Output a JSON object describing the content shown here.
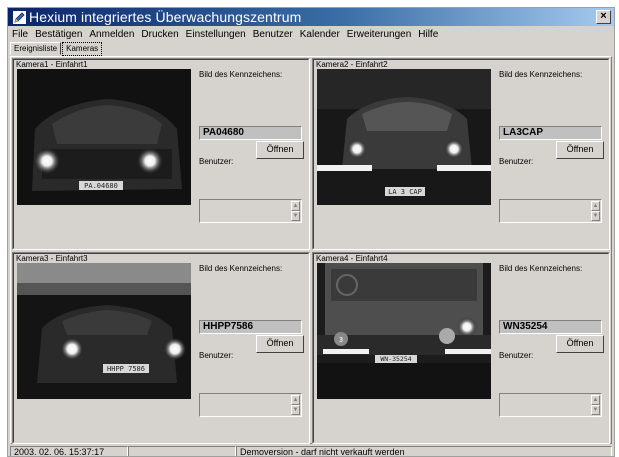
{
  "window": {
    "title": "Hexium integriertes Überwachungszentrum",
    "close_label": "×",
    "app_icon": "pen-icon"
  },
  "menu": [
    "File",
    "Bestätigen",
    "Anmelden",
    "Drucken",
    "Einstellungen",
    "Benutzer",
    "Kalender",
    "Erweiterungen",
    "Hilfe"
  ],
  "tabs": [
    {
      "label": "Ereignisliste",
      "active": false
    },
    {
      "label": "Kameras",
      "active": true
    }
  ],
  "cameras": [
    {
      "name": "Kamera1 - Einfahrt1",
      "plate_label": "Bild des Kennzeichens:",
      "plate": "PA04680",
      "photo_plate": "PA.04680",
      "user_label": "Benutzer:",
      "open_label": "Öffnen"
    },
    {
      "name": "Kamera2 - Einfahrt2",
      "plate_label": "Bild des Kennzeichens:",
      "plate": "LA3CAP",
      "photo_plate": "LA 3 CAP",
      "user_label": "Benutzer:",
      "open_label": "Öffnen"
    },
    {
      "name": "Kamera3 - Einfahrt3",
      "plate_label": "Bild des Kennzeichens:",
      "plate": "HHPP7586",
      "photo_plate": "HHPP 7586",
      "user_label": "Benutzer:",
      "open_label": "Öffnen"
    },
    {
      "name": "Kamera4 - Einfahrt4",
      "plate_label": "Bild des Kennzeichens:",
      "plate": "WN35254",
      "photo_plate": "WN-35254",
      "user_label": "Benutzer:",
      "open_label": "Öffnen"
    }
  ],
  "status": {
    "datetime": "2003. 02. 06. 15:37:17",
    "message": "Demoversion - darf nicht verkauft werden"
  }
}
